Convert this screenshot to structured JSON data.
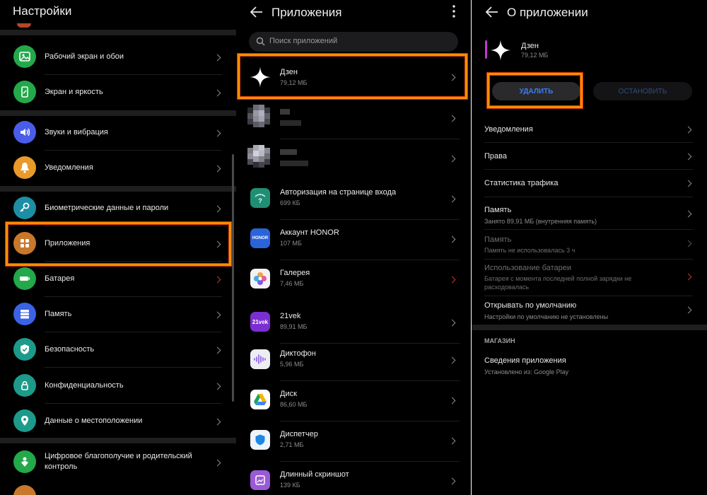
{
  "settings": {
    "title": "Настройки",
    "items": [
      {
        "label": "Рабочий экран и обои"
      },
      {
        "label": "Экран и яркость"
      },
      {
        "label": "Звуки и вибрация"
      },
      {
        "label": "Уведомления"
      },
      {
        "label": "Биометрические данные и пароли"
      },
      {
        "label": "Приложения"
      },
      {
        "label": "Батарея"
      },
      {
        "label": "Память"
      },
      {
        "label": "Безопасность"
      },
      {
        "label": "Конфиденциальность"
      },
      {
        "label": "Данные о местоположении"
      },
      {
        "label": "Цифровое благополучие и родительский контроль"
      }
    ]
  },
  "apps": {
    "title": "Приложения",
    "search_placeholder": "Поиск приложений",
    "items": [
      {
        "name": "Дзен",
        "size": "79,12 МБ"
      },
      {
        "name": "Авторизация на странице входа",
        "size": "699 КБ"
      },
      {
        "name": "Аккаунт HONOR",
        "size": "107 МБ",
        "icon_text": "HONOR"
      },
      {
        "name": "Галерея",
        "size": "7,46 МБ"
      },
      {
        "name": "21vek",
        "size": "89,91 МБ",
        "icon_text": "21vek"
      },
      {
        "name": "Диктофон",
        "size": "5,96 МБ"
      },
      {
        "name": "Диск",
        "size": "86,60 МБ"
      },
      {
        "name": "Диспетчер",
        "size": "2,71 МБ"
      },
      {
        "name": "Длинный скриншот",
        "size": "139 КБ"
      }
    ]
  },
  "details": {
    "title": "О приложении",
    "app_name": "Дзен",
    "app_size": "79,12 МБ",
    "uninstall_label": "УДАЛИТЬ",
    "stop_label": "ОСТАНОВИТЬ",
    "rows": [
      {
        "title": "Уведомления"
      },
      {
        "title": "Права"
      },
      {
        "title": "Статистика трафика"
      },
      {
        "title": "Память",
        "sub": "Занято 89,91 МБ (внутренняя память)"
      },
      {
        "title": "Память",
        "sub": "Память не использовалась 3 ч"
      },
      {
        "title": "Использование батареи",
        "sub": "Батарея с момента последней полной зарядки не расходовалась"
      },
      {
        "title": "Открывать по умолчанию",
        "sub": "Настройки по умолчанию не установлены"
      }
    ],
    "store_header": "МАГАЗИН",
    "store_row": {
      "title": "Сведения приложения",
      "sub": "Установлено из: Google Play"
    }
  },
  "colors": {
    "background": "#000000",
    "highlight": "#ff8c00",
    "uninstall_text": "#3d7cf2",
    "chevron": "#8a8a8a"
  }
}
